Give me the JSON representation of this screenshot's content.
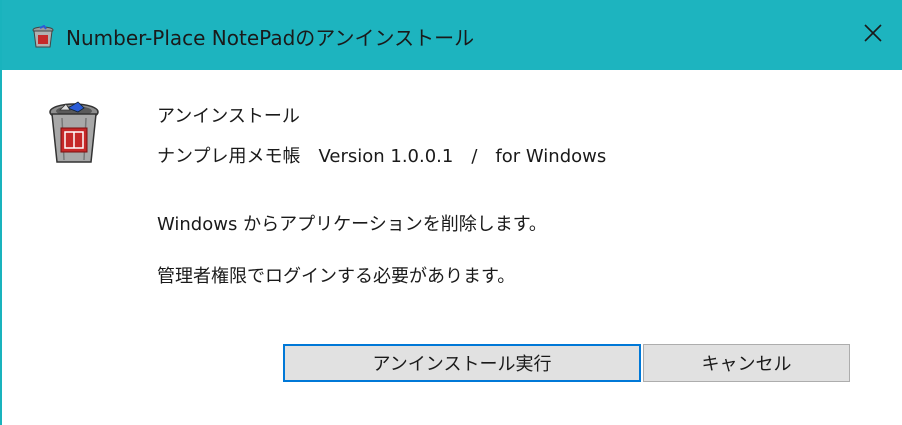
{
  "window": {
    "title": "Number-Place NotePadのアンインストール",
    "titlebar_color": "#1db4bf",
    "title_icon": "trash-bin-icon",
    "close_icon": "close-icon"
  },
  "header": {
    "icon": "trash-bin-icon",
    "line1": "アンインストール",
    "line2": "ナンプレ用メモ帳　Version 1.0.0.1　/　for Windows"
  },
  "body": {
    "message1": "Windows からアプリケーションを削除します。",
    "message2": "管理者権限でログインする必要があります。"
  },
  "buttons": {
    "uninstall_label": "アンインストール実行",
    "cancel_label": "キャンセル",
    "focus_color": "#0078d7"
  }
}
